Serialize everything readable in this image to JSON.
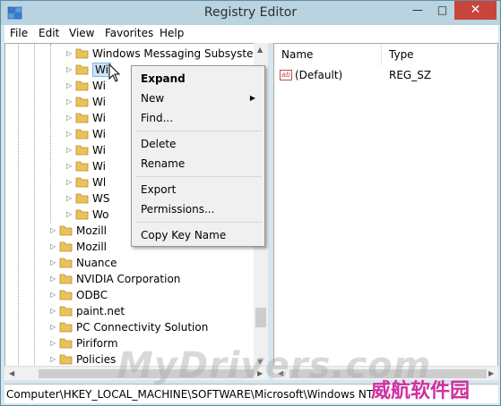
{
  "window": {
    "title": "Registry Editor",
    "controls": {
      "minimize": "—",
      "maximize": "□",
      "close": "✕"
    }
  },
  "menubar": [
    "File",
    "Edit",
    "View",
    "Favorites",
    "Help"
  ],
  "tree": {
    "nested_items": [
      {
        "label": "Windows Messaging Subsystem",
        "selected": false
      },
      {
        "label": "Wi",
        "selected": true
      },
      {
        "label": "Wi",
        "selected": false
      },
      {
        "label": "Wi",
        "selected": false
      },
      {
        "label": "Wi",
        "selected": false
      },
      {
        "label": "Wi",
        "selected": false
      },
      {
        "label": "Wi",
        "selected": false
      },
      {
        "label": "Wi",
        "selected": false
      },
      {
        "label": "Wl",
        "selected": false
      },
      {
        "label": "WS",
        "selected": false
      },
      {
        "label": "Wo",
        "selected": false
      }
    ],
    "items": [
      "Mozill",
      "Mozill",
      "Nuance",
      "NVIDIA Corporation",
      "ODBC",
      "paint.net",
      "PC Connectivity Solution",
      "Piriform",
      "Policies"
    ]
  },
  "list": {
    "columns": [
      "Name",
      "Type"
    ],
    "rows": [
      {
        "name": "(Default)",
        "type": "REG_SZ",
        "icon": "ab"
      }
    ]
  },
  "context_menu": {
    "expand": "Expand",
    "new": "New",
    "find": "Find...",
    "delete": "Delete",
    "rename": "Rename",
    "export": "Export",
    "permissions": "Permissions...",
    "copy_key_name": "Copy Key Name"
  },
  "status": {
    "path": "Computer\\HKEY_LOCAL_MACHINE\\SOFTWARE\\Microsoft\\Windows NT"
  },
  "watermark": {
    "text": "MyDrivers.com",
    "cn_text": "威航软件园"
  },
  "colors": {
    "titlebar": "#b9d3e0",
    "close_button": "#c7453a",
    "selection": "#cce4f7",
    "folder": "#e8c25a",
    "watermark_cn": "#d12ea0"
  }
}
